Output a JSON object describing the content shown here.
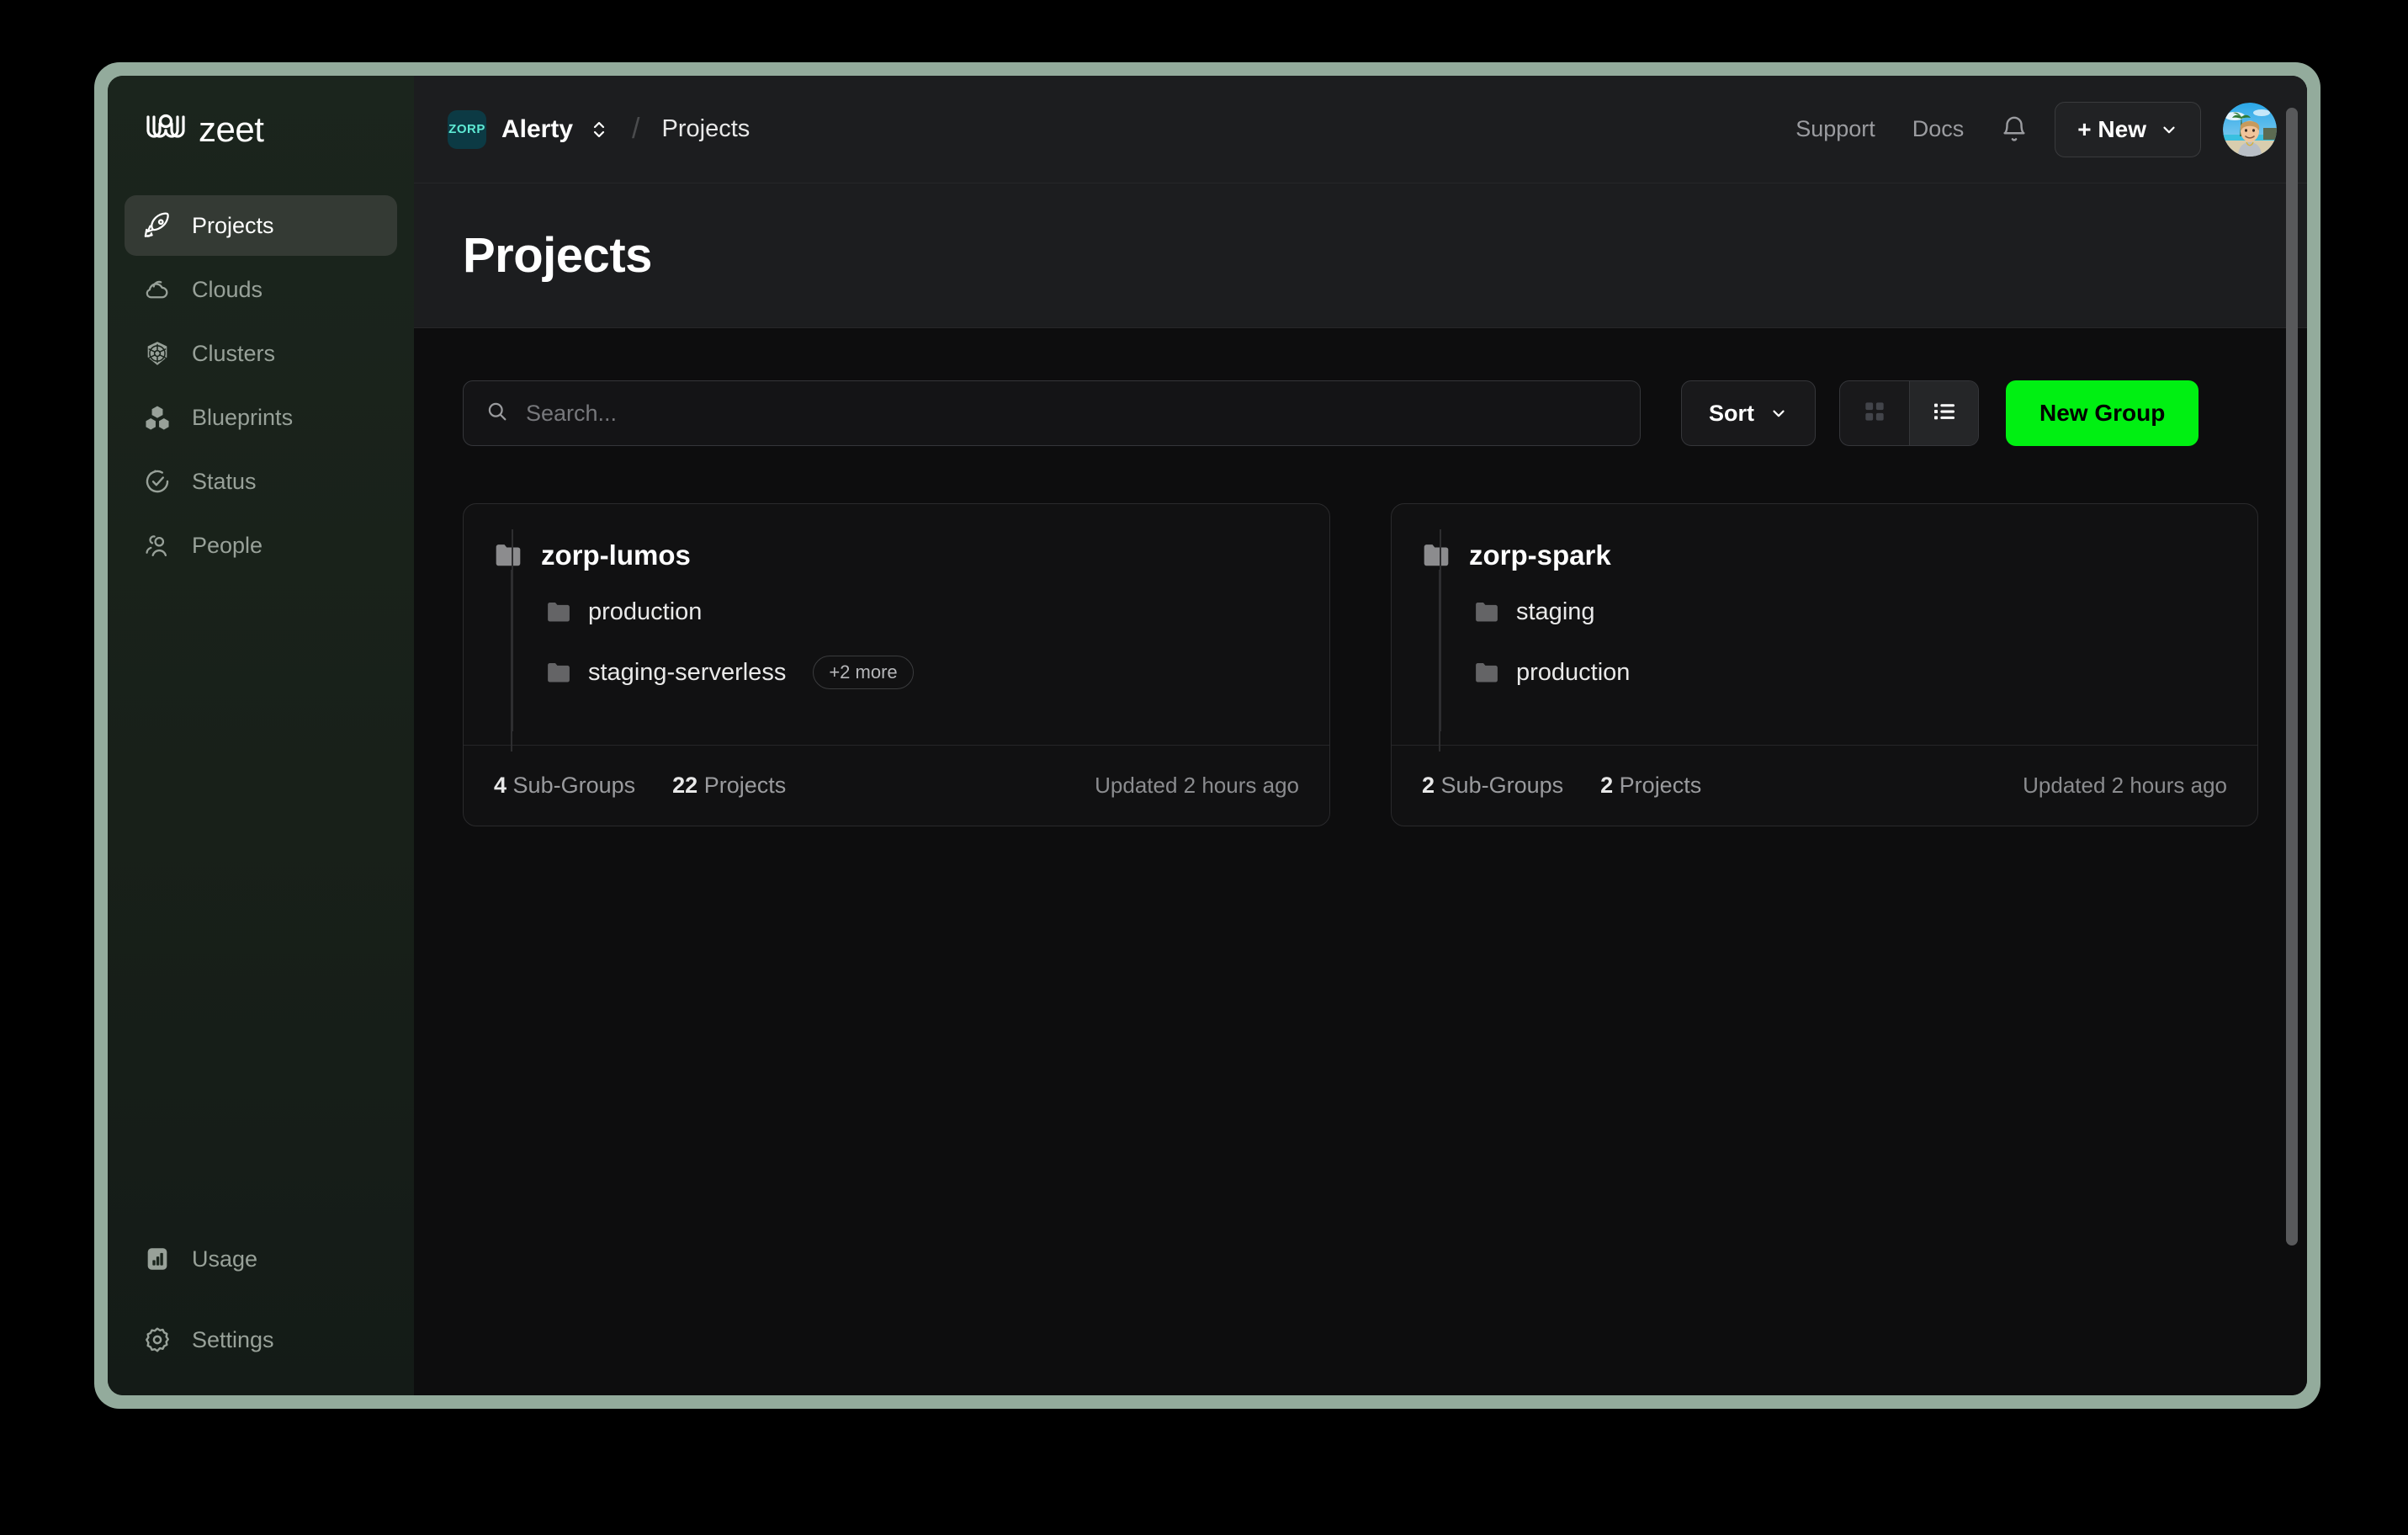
{
  "theme": {
    "frame_color": "#93ab9c",
    "sidebar_bg": "#1b251d",
    "body_bg": "#0d0d0e",
    "header_bg": "#1c1d1f",
    "accent_green": "#00f012",
    "badge_teal": "#5eead4"
  },
  "sidebar": {
    "logo_text": "zeet",
    "items": [
      {
        "label": "Projects",
        "icon": "rocket-icon",
        "active": true
      },
      {
        "label": "Clouds",
        "icon": "cloud-icon",
        "active": false
      },
      {
        "label": "Clusters",
        "icon": "kubernetes-icon",
        "active": false
      },
      {
        "label": "Blueprints",
        "icon": "cubes-icon",
        "active": false
      },
      {
        "label": "Status",
        "icon": "check-circle-icon",
        "active": false
      },
      {
        "label": "People",
        "icon": "people-icon",
        "active": false
      }
    ],
    "bottom_items": [
      {
        "label": "Usage",
        "icon": "bar-chart-icon"
      },
      {
        "label": "Settings",
        "icon": "gear-icon"
      }
    ]
  },
  "topbar": {
    "org_badge_text": "ZORP",
    "org_name": "Alerty",
    "breadcrumb_separator": "/",
    "breadcrumb_current": "Projects",
    "support_label": "Support",
    "docs_label": "Docs",
    "notifications_icon": "bell-icon",
    "new_button_label": "+ New",
    "new_button_icon": "chevron-down-icon",
    "avatar_alt": "user-avatar"
  },
  "page": {
    "title": "Projects"
  },
  "toolbar": {
    "search_placeholder": "Search...",
    "search_value": "",
    "search_icon": "search-icon",
    "sort_label": "Sort",
    "sort_icon": "chevron-down-icon",
    "grid_view_icon": "grid-view-icon",
    "list_view_icon": "list-view-icon",
    "active_view": "list",
    "new_group_label": "New Group"
  },
  "groups": [
    {
      "name": "zorp-lumos",
      "children": [
        {
          "name": "production",
          "more": null
        },
        {
          "name": "staging-serverless",
          "more": "+2 more"
        }
      ],
      "sub_groups_count": "4",
      "sub_groups_label": "Sub-Groups",
      "projects_count": "22",
      "projects_label": "Projects",
      "updated": "Updated 2 hours ago"
    },
    {
      "name": "zorp-spark",
      "children": [
        {
          "name": "staging",
          "more": null
        },
        {
          "name": "production",
          "more": null
        }
      ],
      "sub_groups_count": "2",
      "sub_groups_label": "Sub-Groups",
      "projects_count": "2",
      "projects_label": "Projects",
      "updated": "Updated 2 hours ago"
    }
  ]
}
